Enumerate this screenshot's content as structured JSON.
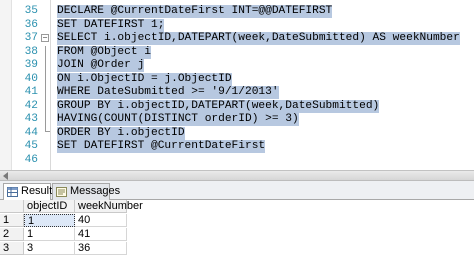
{
  "editor": {
    "lines": [
      {
        "number": "35",
        "code": "DECLARE @CurrentDateFirst INT=@@DATEFIRST"
      },
      {
        "number": "36",
        "code": "SET DATEFIRST 1;"
      },
      {
        "number": "37",
        "code": "SELECT i.objectID,DATEPART(week,DateSubmitted) AS weekNumber"
      },
      {
        "number": "38",
        "code": "FROM @Object i"
      },
      {
        "number": "39",
        "code": "JOIN @Order j"
      },
      {
        "number": "40",
        "code": "ON i.ObjectID = j.ObjectID"
      },
      {
        "number": "41",
        "code": "WHERE DateSubmitted >= '9/1/2013'"
      },
      {
        "number": "42",
        "code": "GROUP BY i.objectID,DATEPART(week,DateSubmitted)"
      },
      {
        "number": "43",
        "code": "HAVING(COUNT(DISTINCT orderID) >= 3)"
      },
      {
        "number": "44",
        "code": "ORDER BY i.objectID"
      },
      {
        "number": "45",
        "code": "SET DATEFIRST @CurrentDateFirst"
      },
      {
        "number": "46",
        "code": ""
      }
    ],
    "selection_color": "#b7c8e0",
    "line_number_color": "#2b91af",
    "fold_icon": "minus-box-icon"
  },
  "results_pane": {
    "tabs": [
      {
        "label": "Results",
        "icon": "grid-icon",
        "active": true
      },
      {
        "label": "Messages",
        "icon": "message-icon",
        "active": false
      }
    ],
    "columns": [
      "objectID",
      "weekNumber"
    ],
    "rows": [
      {
        "row_number": "1",
        "objectID": "1",
        "weekNumber": "40"
      },
      {
        "row_number": "2",
        "objectID": "1",
        "weekNumber": "41"
      },
      {
        "row_number": "3",
        "objectID": "3",
        "weekNumber": "36"
      }
    ]
  }
}
